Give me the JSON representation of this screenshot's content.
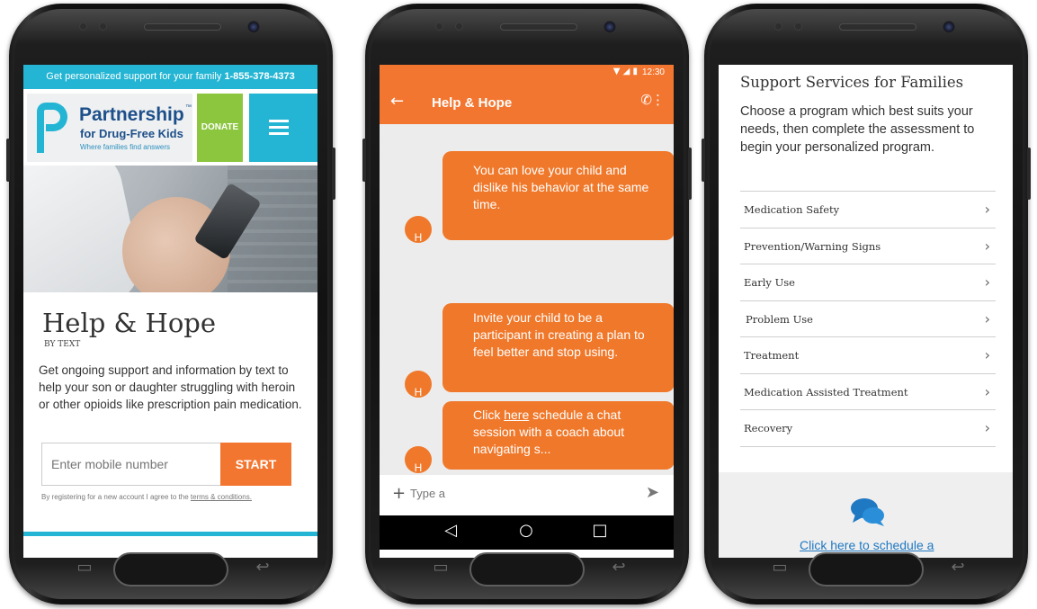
{
  "phone1": {
    "top_bar": {
      "text": "Get personalized support for your family",
      "phone": "1-855-378-4373"
    },
    "logo": {
      "title": "Partnership",
      "tm": "™",
      "subtitle": "for Drug-Free Kids",
      "tagline": "Where families find answers"
    },
    "donate_label": "DONATE",
    "title": "Help & Hope",
    "subtitle": "BY TEXT",
    "body": "Get ongoing support and information by text to help your son or daughter struggling with heroin or other opioids like prescription pain medication.",
    "input_placeholder": "Enter mobile number",
    "start_label": "START",
    "terms_prefix": "By registering for a new account I agree to the",
    "terms_link": "terms & conditions."
  },
  "phone2": {
    "status_time": "12:30",
    "title": "Help & Hope",
    "avatar_letter": "H",
    "messages": [
      {
        "text": "You can love your child and dislike his behavior at the same time."
      },
      {
        "text": "Invite your child to be a participant in creating a plan to feel better and stop using."
      },
      {
        "prefix": "Click",
        "link": "here",
        "text": "schedule a chat session with a coach about navigating s..."
      }
    ],
    "input_placeholder": "Type a"
  },
  "phone3": {
    "title": "Support Services for Families",
    "intro": "Choose a program which best suits your needs, then complete the assessment to begin your personalized program.",
    "items": [
      {
        "label": "Medication Safety"
      },
      {
        "label": "Prevention/Warning Signs"
      },
      {
        "label": "Early Use"
      },
      {
        "label": "Problem Use"
      },
      {
        "label": "Treatment"
      },
      {
        "label": "Medication Assisted Treatment"
      },
      {
        "label": "Recovery"
      }
    ],
    "schedule_link": "Click here to schedule a"
  },
  "colors": {
    "brand_blue": "#23b5d3",
    "orange": "#f37630",
    "green": "#8cc63f",
    "navy": "#1d4f8a",
    "link_blue": "#1f78c2"
  }
}
